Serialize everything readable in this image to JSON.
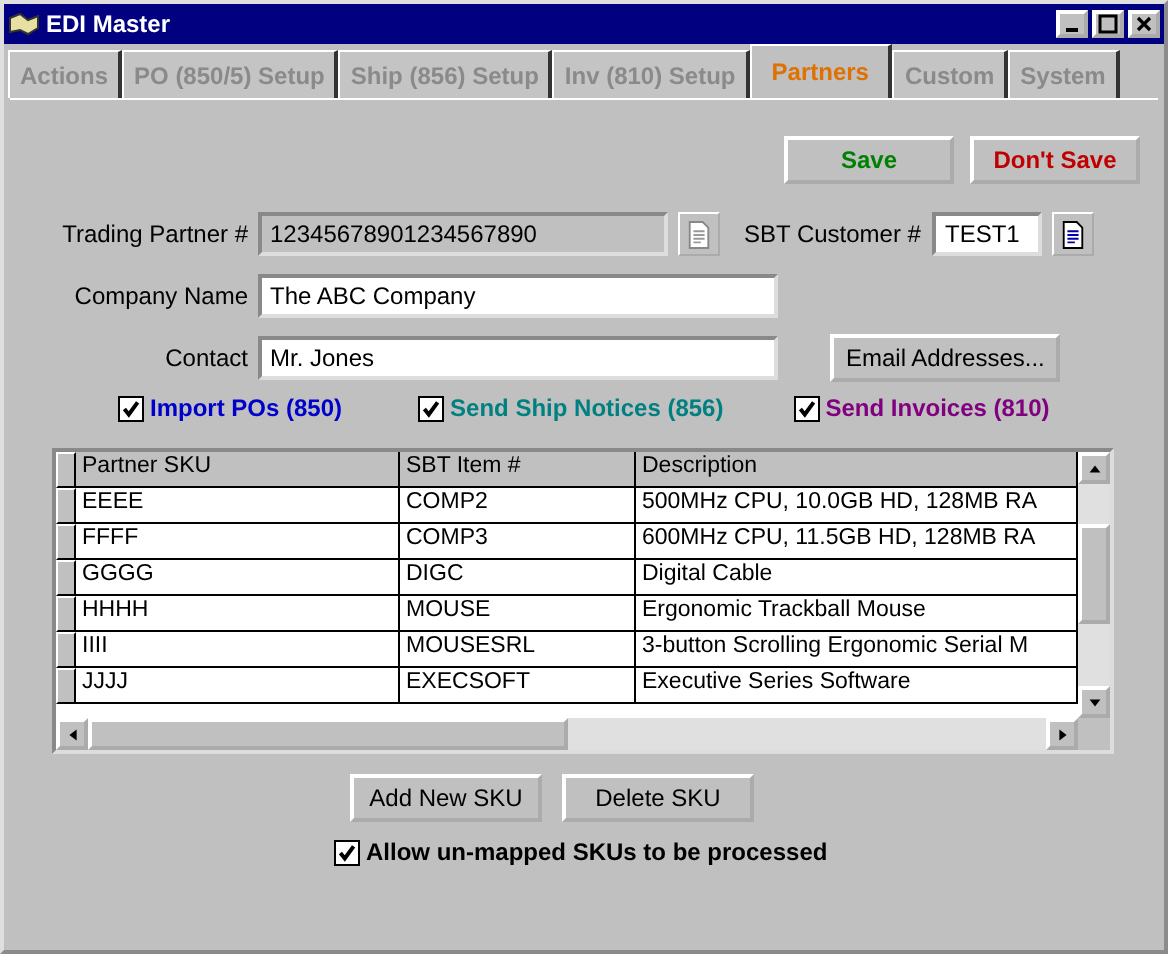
{
  "window": {
    "title": "EDI Master"
  },
  "tabs": [
    {
      "label": "Actions",
      "selected": false
    },
    {
      "label": "PO (850/5) Setup",
      "selected": false
    },
    {
      "label": "Ship (856) Setup",
      "selected": false
    },
    {
      "label": "Inv (810) Setup",
      "selected": false
    },
    {
      "label": "Partners",
      "selected": true
    },
    {
      "label": "Custom",
      "selected": false
    },
    {
      "label": "System",
      "selected": false
    }
  ],
  "actions": {
    "save": "Save",
    "dont_save": "Don't Save"
  },
  "form": {
    "trading_partner": {
      "label": "Trading Partner #",
      "value": "12345678901234567890",
      "disabled": true
    },
    "sbt_customer": {
      "label": "SBT Customer #",
      "value": "TEST1"
    },
    "company_name": {
      "label": "Company Name",
      "value": "The ABC Company"
    },
    "contact": {
      "label": "Contact",
      "value": "Mr. Jones"
    },
    "email_button": "Email Addresses..."
  },
  "options": [
    {
      "label": "Import POs (850)",
      "checked": true,
      "color": "#0000cc"
    },
    {
      "label": "Send Ship Notices (856)",
      "checked": true,
      "color": "#008080"
    },
    {
      "label": "Send Invoices (810)",
      "checked": true,
      "color": "#800080"
    }
  ],
  "table": {
    "columns": [
      "Partner SKU",
      "SBT Item #",
      "Description"
    ],
    "rows": [
      [
        "EEEE",
        "COMP2",
        "500MHz CPU, 10.0GB HD, 128MB RA"
      ],
      [
        "FFFF",
        "COMP3",
        "600MHz CPU, 11.5GB HD, 128MB RA"
      ],
      [
        "GGGG",
        "DIGC",
        "Digital Cable"
      ],
      [
        "HHHH",
        "MOUSE",
        "Ergonomic Trackball Mouse"
      ],
      [
        "IIII",
        "MOUSESRL",
        "3-button Scrolling Ergonomic Serial M"
      ],
      [
        "JJJJ",
        "EXECSOFT",
        "Executive Series Software"
      ]
    ]
  },
  "sku_buttons": [
    "Add New SKU",
    "Delete SKU"
  ],
  "allow_unmapped": {
    "label": "Allow un-mapped SKUs to be processed",
    "checked": true
  }
}
